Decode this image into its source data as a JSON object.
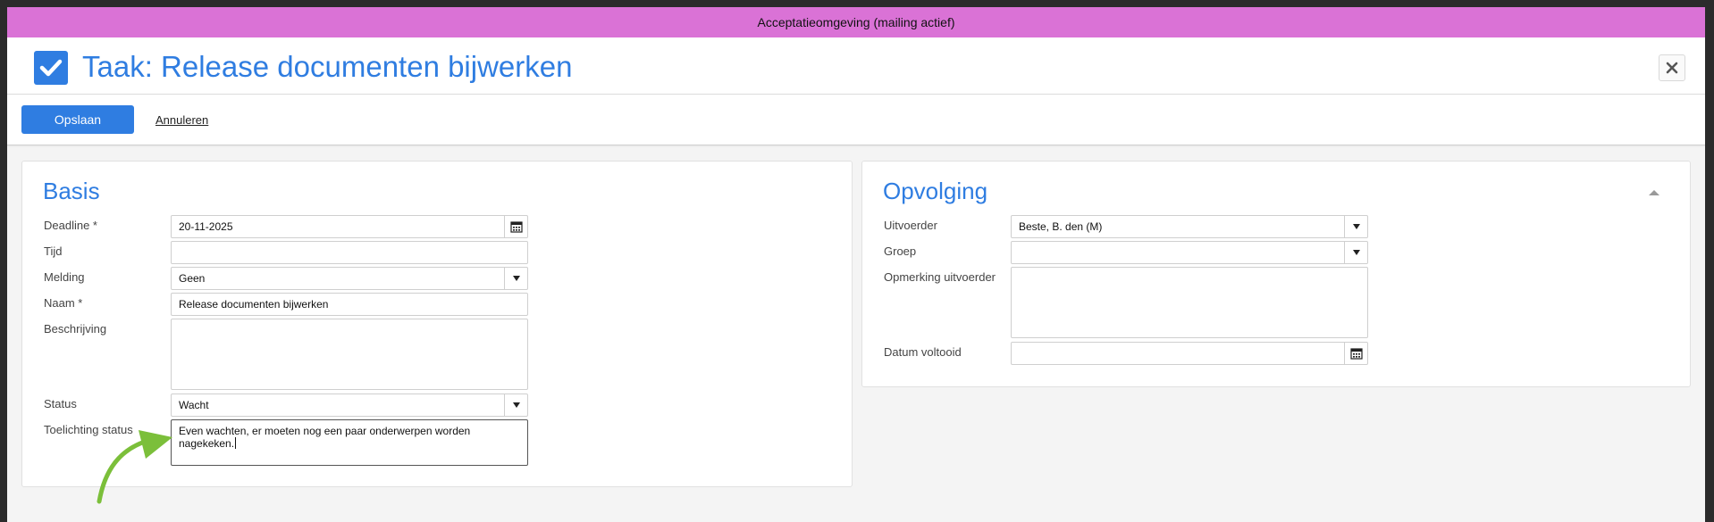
{
  "env_banner": "Acceptatieomgeving (mailing actief)",
  "header": {
    "title": "Taak: Release documenten bijwerken",
    "check_icon": "checkbox-checked-icon",
    "close_icon": "close-icon"
  },
  "toolbar": {
    "save_label": "Opslaan",
    "cancel_label": "Annuleren"
  },
  "basis": {
    "title": "Basis",
    "deadline_label": "Deadline *",
    "deadline_value": "20-11-2025",
    "tijd_label": "Tijd",
    "tijd_value": "",
    "melding_label": "Melding",
    "melding_value": "Geen",
    "naam_label": "Naam *",
    "naam_value": "Release documenten bijwerken",
    "beschrijving_label": "Beschrijving",
    "beschrijving_value": "",
    "status_label": "Status",
    "status_value": "Wacht",
    "toelichting_label": "Toelichting status",
    "toelichting_value": "Even wachten, er moeten nog een paar onderwerpen worden nagekeken."
  },
  "opvolging": {
    "title": "Opvolging",
    "uitvoerder_label": "Uitvoerder",
    "uitvoerder_value": "Beste, B. den (M)",
    "groep_label": "Groep",
    "groep_value": "",
    "opmerking_label": "Opmerking uitvoerder",
    "opmerking_value": "",
    "datum_label": "Datum voltooid",
    "datum_value": ""
  },
  "colors": {
    "accent": "#2f7de1",
    "banner": "#da72d6",
    "annotation_arrow": "#7bbf3a"
  }
}
